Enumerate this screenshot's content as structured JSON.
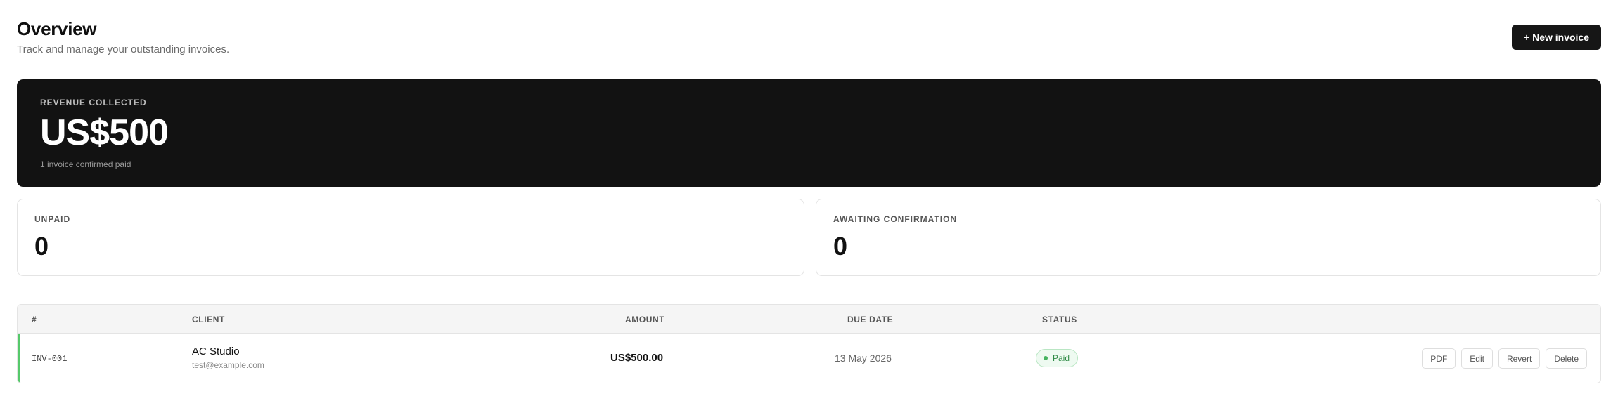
{
  "header": {
    "title": "Overview",
    "subtitle": "Track and manage your outstanding invoices.",
    "new_invoice_label": "+ New invoice"
  },
  "revenue": {
    "label": "REVENUE COLLECTED",
    "value": "US$500",
    "note": "1 invoice confirmed paid"
  },
  "stats": {
    "unpaid": {
      "label": "UNPAID",
      "value": "0"
    },
    "awaiting": {
      "label": "AWAITING CONFIRMATION",
      "value": "0"
    }
  },
  "table": {
    "columns": {
      "num": "#",
      "client": "CLIENT",
      "amount": "AMOUNT",
      "due": "DUE DATE",
      "status": "STATUS"
    },
    "rows": [
      {
        "id": "INV-001",
        "client_name": "AC Studio",
        "client_email": "test@example.com",
        "amount": "US$500.00",
        "due_date": "13 May 2026",
        "status": "Paid",
        "actions": {
          "pdf": "PDF",
          "edit": "Edit",
          "revert": "Revert",
          "delete": "Delete"
        }
      }
    ]
  },
  "colors": {
    "revenue_card_bg": "#121212",
    "primary_button_bg": "#161616",
    "paid_accent": "#56c96b",
    "paid_badge_bg": "#eefaf1",
    "paid_badge_text": "#2e8a45"
  }
}
